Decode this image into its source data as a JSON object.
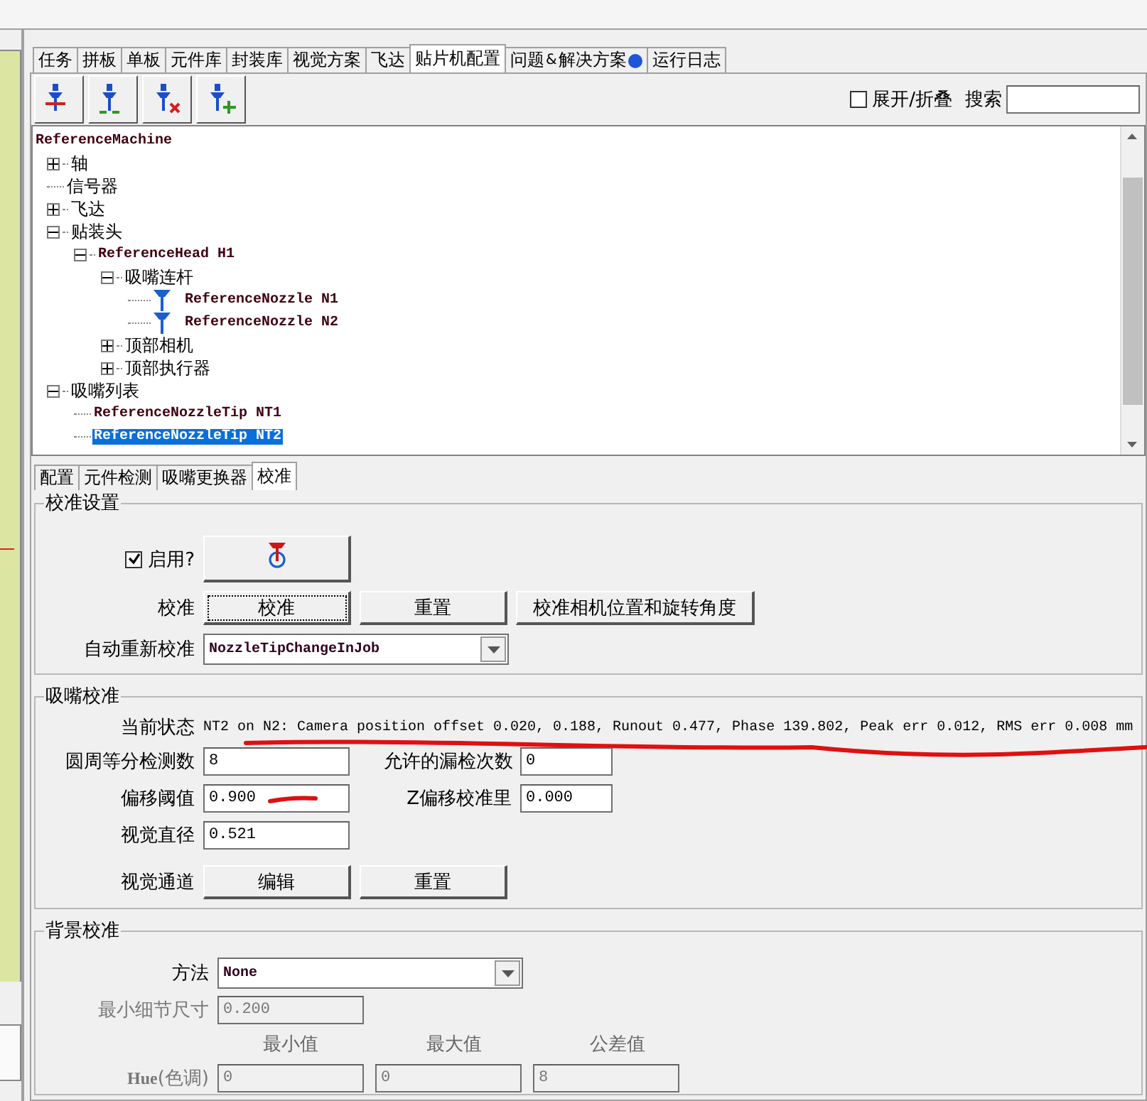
{
  "tabs": [
    {
      "label": "任务",
      "selected": false,
      "alert": false
    },
    {
      "label": "拼板",
      "selected": false,
      "alert": false
    },
    {
      "label": "单板",
      "selected": false,
      "alert": false
    },
    {
      "label": "元件库",
      "selected": false,
      "alert": false
    },
    {
      "label": "封装库",
      "selected": false,
      "alert": false
    },
    {
      "label": "视觉方案",
      "selected": false,
      "alert": false
    },
    {
      "label": "飞达",
      "selected": false,
      "alert": false
    },
    {
      "label": "贴片机配置",
      "selected": true,
      "alert": false
    },
    {
      "label": "问题&解决方案",
      "selected": false,
      "alert": true
    },
    {
      "label": "运行日志",
      "selected": false,
      "alert": false
    }
  ],
  "toolbar": {
    "buttons": [
      {
        "kind": "plain"
      },
      {
        "kind": "remove"
      },
      {
        "kind": "delete"
      },
      {
        "kind": "add"
      }
    ],
    "expand_collapse": {
      "label": "展开/折叠",
      "checked": false
    },
    "search": {
      "label": "搜索"
    }
  },
  "tree": {
    "label": "ReferenceMachine",
    "kind": "root",
    "selected": false,
    "children": [
      {
        "label": "轴",
        "kind": "branch",
        "expanded": false,
        "selected": false
      },
      {
        "label": "信号器",
        "kind": "leaf",
        "selected": false
      },
      {
        "label": "飞达",
        "kind": "branch",
        "expanded": false,
        "selected": false
      },
      {
        "label": "贴装头",
        "kind": "branch",
        "expanded": true,
        "selected": false,
        "children": [
          {
            "label": "ReferenceHead H1",
            "kind": "branch",
            "expanded": true,
            "selected": false,
            "children": [
              {
                "label": "吸嘴连杆",
                "kind": "branch",
                "expanded": true,
                "selected": false,
                "children": [
                  {
                    "label": "ReferenceNozzle N1",
                    "kind": "nozzle",
                    "selected": false
                  },
                  {
                    "label": "ReferenceNozzle N2",
                    "kind": "nozzle",
                    "selected": false
                  }
                ]
              },
              {
                "label": "顶部相机",
                "kind": "branch",
                "expanded": false,
                "selected": false
              },
              {
                "label": "顶部执行器",
                "kind": "branch",
                "expanded": false,
                "selected": false
              }
            ]
          }
        ]
      },
      {
        "label": "吸嘴列表",
        "kind": "branch",
        "expanded": true,
        "selected": false,
        "children": [
          {
            "label": "ReferenceNozzleTip NT1",
            "kind": "leaf",
            "selected": false
          },
          {
            "label": "ReferenceNozzleTip NT2",
            "kind": "leaf",
            "selected": true
          }
        ]
      }
    ]
  },
  "subtabs": [
    {
      "label": "配置",
      "selected": false
    },
    {
      "label": "元件检测",
      "selected": false
    },
    {
      "label": "吸嘴更换器",
      "selected": false
    },
    {
      "label": "校准",
      "selected": true
    }
  ],
  "calibration_settings": {
    "title": "校准设置",
    "enabled": {
      "label": "启用?",
      "checked": true
    },
    "calibrate_label": "校准",
    "buttons": [
      "校准",
      "重置",
      "校准相机位置和旋转角度"
    ],
    "auto_label": "自动重新校准",
    "auto_value": "NozzleTipChangeInJob"
  },
  "nozzle_calibration": {
    "title": "吸嘴校准",
    "status_label": "当前状态",
    "status_value": "NT2 on N2: Camera position offset 0.020, 0.188, Runout 0.477, Phase 139.802, Peak err 0.012, RMS err 0.008 mm",
    "status_underlined": true,
    "fields": [
      {
        "label": "圆周等分检测数",
        "value": "8",
        "underlined": false
      },
      {
        "label": "允许的漏检次数",
        "value": "0",
        "underlined": false
      },
      {
        "label": "偏移阈值",
        "value": "0.900",
        "underlined": true
      },
      {
        "label": "Z偏移校准里",
        "value": "0.000",
        "underlined": false
      },
      {
        "label": "视觉直径",
        "value": "0.521",
        "underlined": false
      }
    ],
    "vision_label": "视觉通道",
    "buttons": [
      "编辑",
      "重置"
    ]
  },
  "background_calibration": {
    "title": "背景校准",
    "method_label": "方法",
    "method_value": "None",
    "min_feature_label": "最小细节尺寸",
    "min_feature_value": "0.200",
    "disabled": true,
    "columns": [
      "最小值",
      "最大值",
      "公差值"
    ],
    "rows": [
      {
        "label": "**Hue**(色调)",
        "values": [
          "0",
          "0",
          "8"
        ]
      }
    ]
  }
}
